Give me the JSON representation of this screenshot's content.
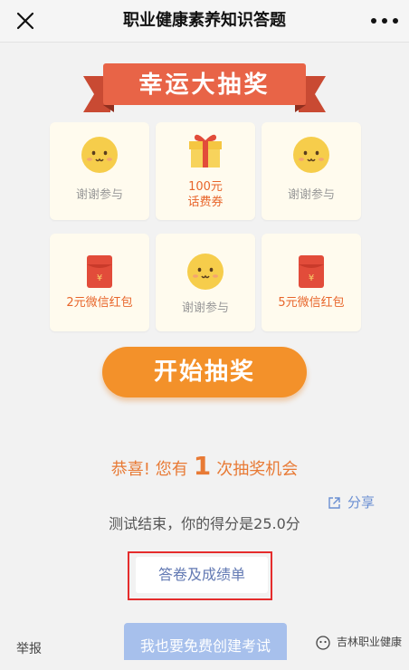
{
  "header": {
    "title": "职业健康素养知识答题"
  },
  "banner": {
    "text": "幸运大抽奖"
  },
  "prizes": [
    {
      "icon": "smiley-icon",
      "label": "谢谢参与"
    },
    {
      "icon": "gift-box-icon",
      "label_line1": "100元",
      "label_line2": "话费券"
    },
    {
      "icon": "smiley-icon",
      "label": "谢谢参与"
    },
    {
      "icon": "red-envelope-icon",
      "label": "2元微信红包"
    },
    {
      "icon": "smiley-icon",
      "label": "谢谢参与"
    },
    {
      "icon": "red-envelope-icon",
      "label": "5元微信红包"
    }
  ],
  "start_button": {
    "label": "开始抽奖"
  },
  "chance": {
    "prefix": "恭喜! 您有",
    "count": "1",
    "suffix": "次抽奖机会"
  },
  "share": {
    "label": "分享"
  },
  "score": {
    "text": "测试结束，你的得分是25.0分"
  },
  "answer_sheet": {
    "label": "答卷及成绩单"
  },
  "footer": {
    "report": "举报",
    "create_label": "我也要免费创建考试"
  },
  "watermark": {
    "text": "吉林职业健康"
  },
  "colors": {
    "accent_orange": "#f3912a",
    "banner_red": "#e86447",
    "card_bg": "#fffbee",
    "highlight_red": "#e52c2c",
    "link_blue": "#6279b3"
  }
}
